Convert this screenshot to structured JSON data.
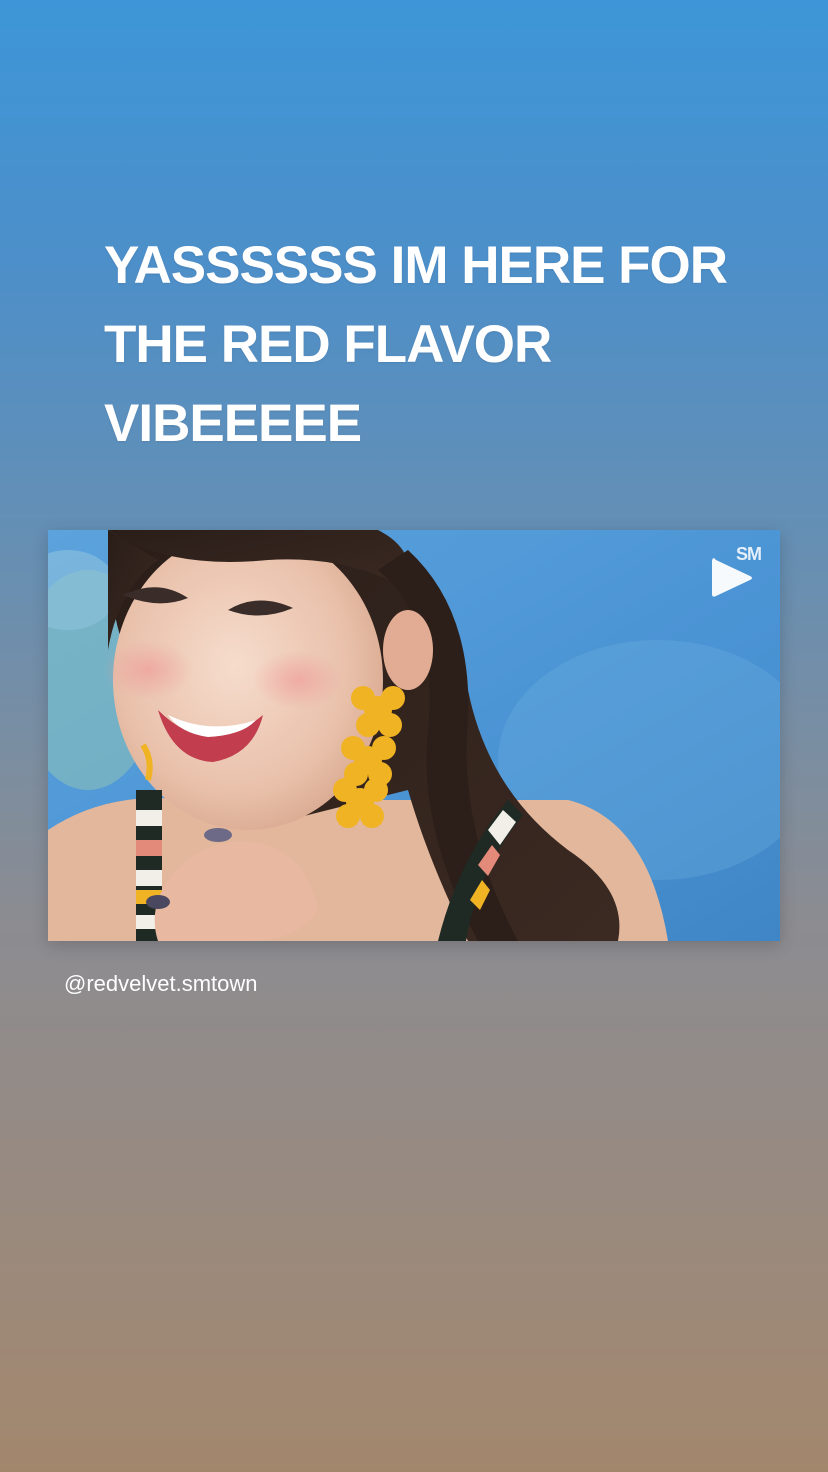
{
  "story": {
    "caption": "YASSSSSS IM HERE FOR THE RED FLAVOR VIBEEEEE"
  },
  "video": {
    "channel_mark": "SM",
    "play_icon": "play-icon"
  },
  "source": {
    "handle": "@redvelvet.smtown"
  },
  "colors": {
    "gradient_top": "#3d96d8",
    "gradient_bottom": "#a3876d",
    "text": "#ffffff"
  }
}
